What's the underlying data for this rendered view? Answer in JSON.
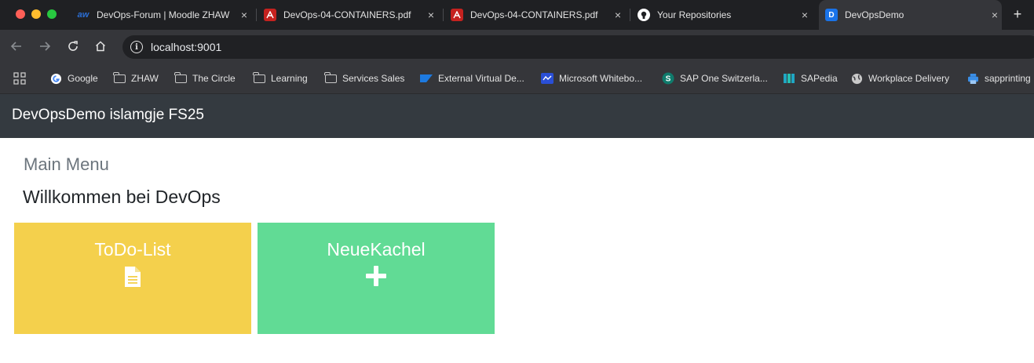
{
  "browser": {
    "tabs": [
      {
        "title": "DevOps-Forum | Moodle ZHAW",
        "icon": "moodle-icon"
      },
      {
        "title": "DevOps-04-CONTAINERS.pdf",
        "icon": "pdf-icon"
      },
      {
        "title": "DevOps-04-CONTAINERS.pdf",
        "icon": "pdf-icon"
      },
      {
        "title": "Your Repositories",
        "icon": "github-icon"
      },
      {
        "title": "DevOpsDemo",
        "icon": "app-icon",
        "active": true
      }
    ],
    "new_tab": "+",
    "close": "×",
    "address": "localhost:9001",
    "bookmarks": [
      {
        "label": "Google",
        "icon": "google-icon"
      },
      {
        "label": "ZHAW",
        "icon": "folder-icon"
      },
      {
        "label": "The Circle",
        "icon": "folder-icon"
      },
      {
        "label": "Learning",
        "icon": "folder-icon"
      },
      {
        "label": "Services Sales",
        "icon": "folder-icon"
      },
      {
        "label": "External Virtual De...",
        "icon": "sap-icon"
      },
      {
        "label": "Microsoft Whitebo...",
        "icon": "whiteboard-icon"
      },
      {
        "label": "SAP One Switzerla...",
        "icon": "sharepoint-icon"
      },
      {
        "label": "SAPedia",
        "icon": "sapedia-icon"
      },
      {
        "label": "Workplace Delivery",
        "icon": "globe-icon"
      },
      {
        "label": "sapprinting",
        "icon": "printer-icon"
      }
    ]
  },
  "app": {
    "brand": "DevOpsDemo islamgje FS25",
    "main_menu": "Main Menu",
    "welcome": "Willkommen bei DevOps",
    "tiles": [
      {
        "title": "ToDo-List",
        "icon": "document-icon",
        "color": "#f4d04c"
      },
      {
        "title": "NeueKachel",
        "icon": "plus-icon",
        "color": "#61db95"
      }
    ]
  },
  "colors": {
    "tabstrip": "#1f2023",
    "toolbar": "#35363a",
    "navbar": "#343a40"
  }
}
